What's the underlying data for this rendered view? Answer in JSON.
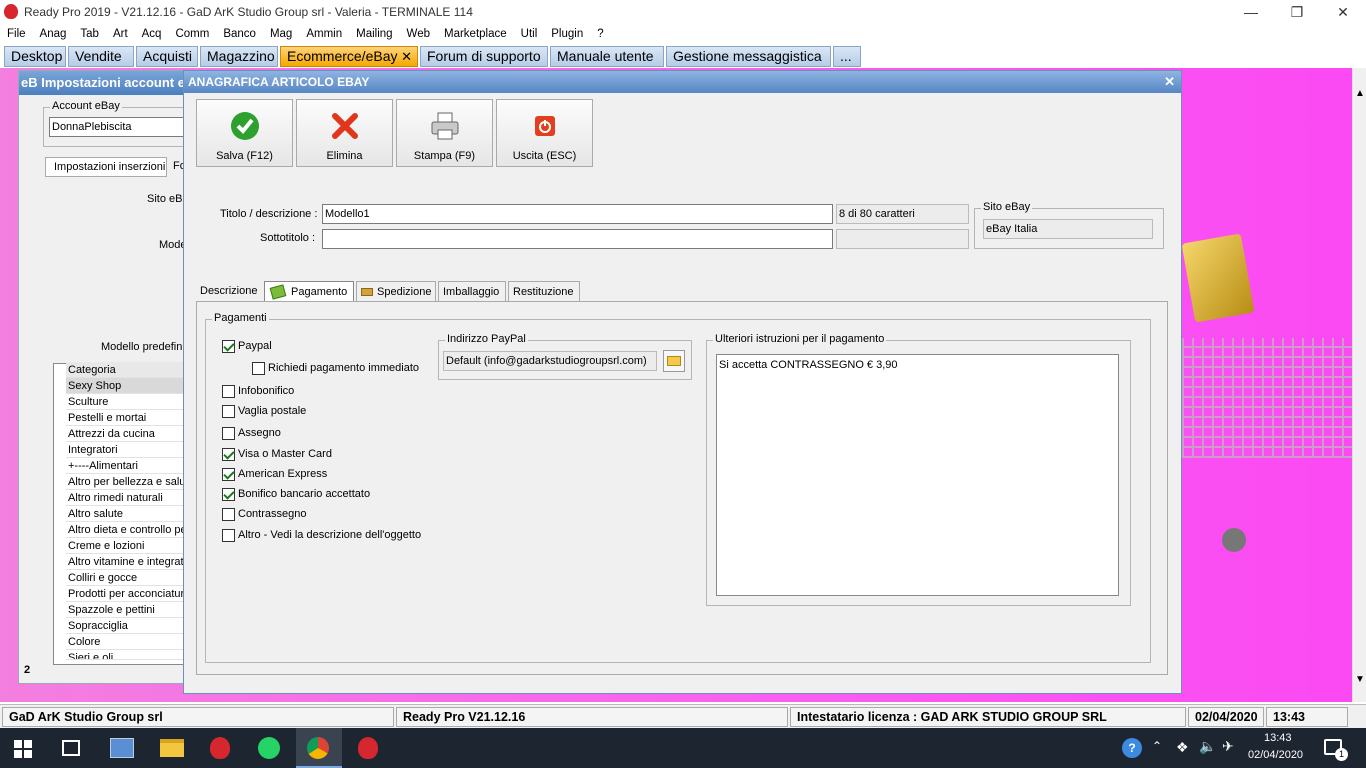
{
  "window": {
    "title": "Ready Pro 2019 - V21.12.16 - GaD ArK Studio Group srl - Valeria - TERMINALE 114"
  },
  "menu": [
    "File",
    "Anag",
    "Tab",
    "Art",
    "Acq",
    "Comm",
    "Banco",
    "Mag",
    "Ammin",
    "Mailing",
    "Web",
    "Marketplace",
    "Util",
    "Plugin",
    "?"
  ],
  "tabs": [
    "Desktop",
    "Vendite",
    "Acquisti",
    "Magazzino",
    "Ecommerce/eBay",
    "Forum di supporto",
    "Manuale utente",
    "Gestione messaggistica",
    "..."
  ],
  "background_window": {
    "title": "eB Impostazioni account e",
    "account_label": "Account eBay",
    "account_value": "DonnaPlebiscita",
    "tab1": "Impostazioni inserzioni",
    "tab2": "Fo",
    "sito_label": "Sito eB",
    "mode_label": "Mode",
    "modello_label": "Modello predefinit",
    "categories_header": "Categoria",
    "categories": [
      "Sexy Shop",
      "Sculture",
      "Pestelli e mortai",
      "Attrezzi da cucina",
      "Integratori",
      "+----Alimentari",
      "Altro per bellezza e salu",
      "Altro rimedi naturali",
      "Altro salute",
      "Altro dieta e controllo pe",
      "Creme e lozioni",
      "Altro vitamine e integrat",
      "Colliri e gocce",
      "Prodotti per acconciatur",
      "Spazzole e pettini",
      "Sopracciglia",
      "Colore",
      "Sieri e oli"
    ],
    "footer_num": "2"
  },
  "dialog": {
    "title": "ANAGRAFICA ARTICOLO EBAY",
    "buttons": {
      "save": "Salva (F12)",
      "delete": "Elimina",
      "print": "Stampa (F9)",
      "exit": "Uscita (ESC)"
    },
    "title_label": "Titolo / descrizione :",
    "title_value": "Modello1",
    "char_count": "8 di 80 caratteri",
    "subtitle_label": "Sottotitolo :",
    "subtitle_value": "",
    "site_group": "Sito eBay",
    "site_value": "eBay Italia",
    "subtabs": [
      "Descrizione",
      "Pagamento",
      "Spedizione",
      "Imballaggio",
      "Restituzione"
    ],
    "payments_group": "Pagamenti",
    "payments": [
      {
        "label": "Paypal",
        "checked": true
      },
      {
        "label": "Richiedi pagamento immediato",
        "checked": false
      },
      {
        "label": "Infobonifico",
        "checked": false
      },
      {
        "label": "Vaglia postale",
        "checked": false
      },
      {
        "label": "Assegno",
        "checked": false
      },
      {
        "label": "Visa o Master Card",
        "checked": true
      },
      {
        "label": "American Express",
        "checked": true
      },
      {
        "label": "Bonifico bancario accettato",
        "checked": true
      },
      {
        "label": "Contrassegno",
        "checked": false
      },
      {
        "label": "Altro - Vedi la descrizione dell'oggetto",
        "checked": false
      }
    ],
    "paypal_group": "Indirizzo PayPal",
    "paypal_value": "Default (info@gadarkstudiogroupsrl.com)",
    "instructions_group": "Ulteriori istruzioni per il pagamento",
    "instructions_value": "Si accetta CONTRASSEGNO € 3,90"
  },
  "statusbar": {
    "company": "GaD ArK Studio Group srl",
    "version": "Ready Pro V21.12.16",
    "license": "Intestatario licenza : GAD ARK STUDIO GROUP SRL",
    "date": "02/04/2020",
    "time": "13:43"
  },
  "taskbar": {
    "time": "13:43",
    "date": "02/04/2020",
    "notifications": "1"
  }
}
